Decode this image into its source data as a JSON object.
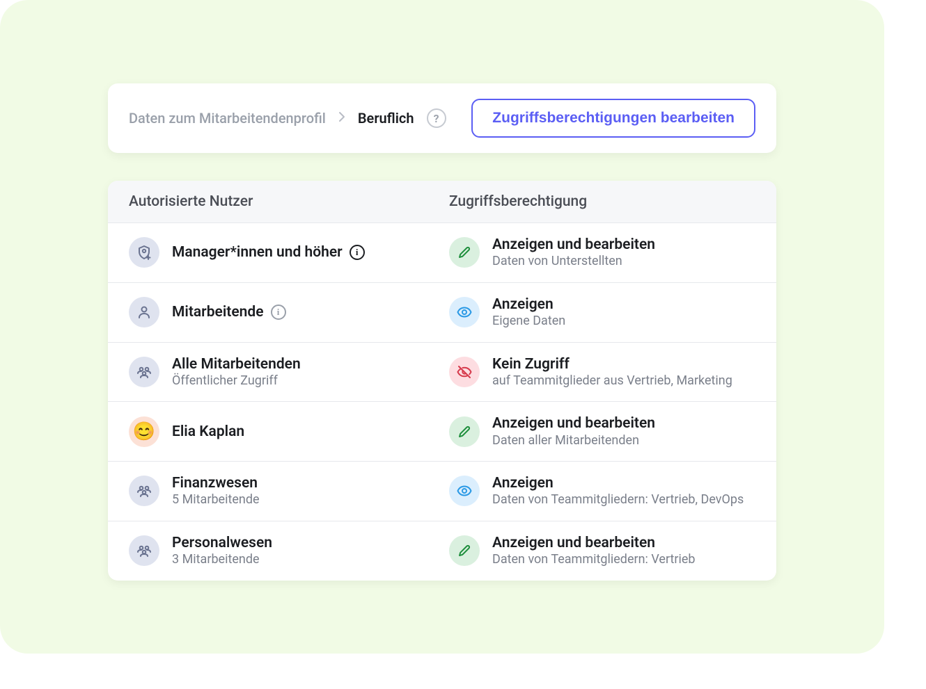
{
  "breadcrumb": {
    "parent": "Daten zum Mitarbeitendenprofil",
    "current": "Beruflich",
    "help_glyph": "?"
  },
  "edit_button": "Zugriffsberechtigungen bearbeiten",
  "columns": {
    "user": "Autorisierte Nutzer",
    "permission": "Zugriffsberechtigung"
  },
  "info_glyph": "i",
  "rows": [
    {
      "user_title": "Manager*innen und höher",
      "user_sub": "",
      "user_icon": "shield-plus",
      "has_info": true,
      "info_dark": true,
      "perm_title": "Anzeigen und bearbeiten",
      "perm_sub": "Daten von Unterstellten",
      "perm_icon": "pencil",
      "perm_color": "green"
    },
    {
      "user_title": "Mitarbeitende",
      "user_sub": "",
      "user_icon": "person",
      "has_info": true,
      "info_dark": false,
      "perm_title": "Anzeigen",
      "perm_sub": "Eigene Daten",
      "perm_icon": "eye",
      "perm_color": "blue"
    },
    {
      "user_title": "Alle Mitarbeitenden",
      "user_sub": "Öffentlicher Zugriff",
      "user_icon": "people",
      "has_info": false,
      "perm_title": "Kein Zugriff",
      "perm_sub": "auf Teammitglieder aus Vertrieb, Marketing",
      "perm_icon": "eye-off",
      "perm_color": "red"
    },
    {
      "user_title": "Elia Kaplan",
      "user_sub": "",
      "user_icon": "avatar",
      "has_info": false,
      "perm_title": "Anzeigen und bearbeiten",
      "perm_sub": "Daten aller Mitarbeitenden",
      "perm_icon": "pencil",
      "perm_color": "green"
    },
    {
      "user_title": "Finanzwesen",
      "user_sub": "5 Mitarbeitende",
      "user_icon": "people",
      "has_info": false,
      "perm_title": "Anzeigen",
      "perm_sub": "Daten von Teammitgliedern: Vertrieb, DevOps",
      "perm_icon": "eye",
      "perm_color": "blue"
    },
    {
      "user_title": "Personalwesen",
      "user_sub": "3 Mitarbeitende",
      "user_icon": "people",
      "has_info": false,
      "perm_title": "Anzeigen und bearbeiten",
      "perm_sub": "Daten von Teammitgliedern: Vertrieb",
      "perm_icon": "pencil",
      "perm_color": "green"
    }
  ]
}
